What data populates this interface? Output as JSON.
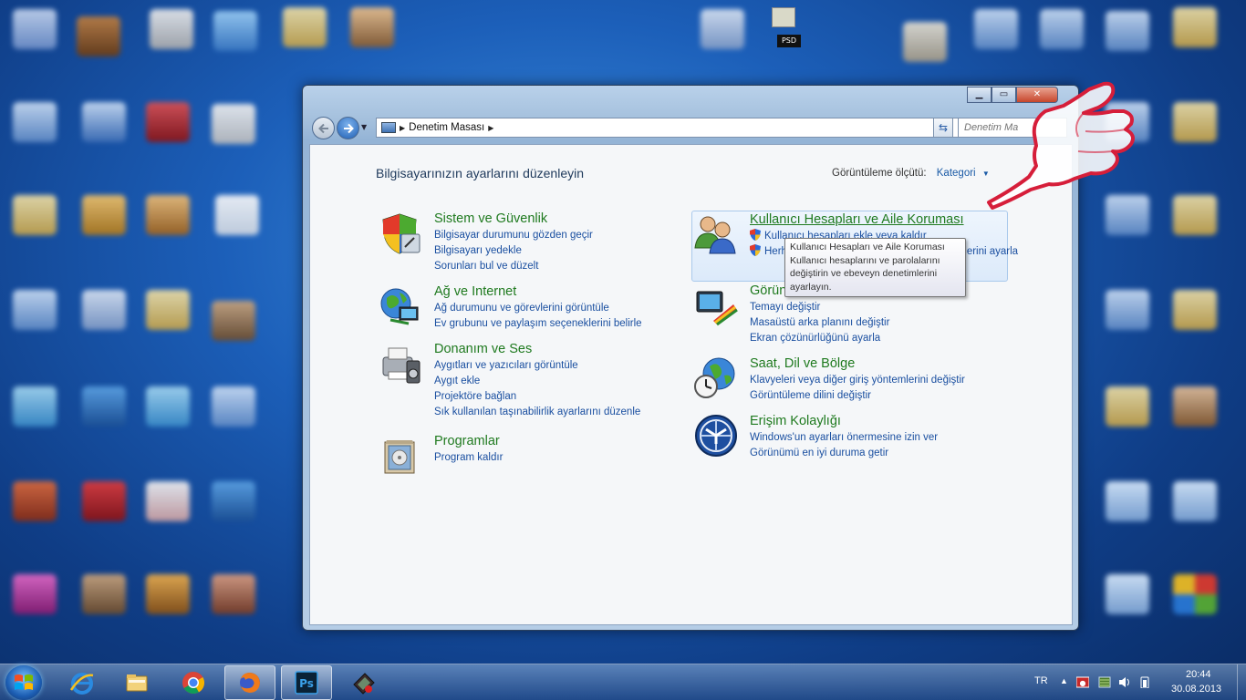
{
  "desktop": {
    "psd_icon_label": "PSD"
  },
  "window": {
    "address": {
      "crumb": "Denetim Masası"
    },
    "search": {
      "placeholder": "Denetim Ma"
    },
    "page_title": "Bilgisayarınızın ayarlarını düzenleyin",
    "view_by": {
      "label": "Görüntüleme ölçütü:",
      "value": "Kategori"
    },
    "left_categories": [
      {
        "title": "Sistem ve Güvenlik",
        "icon": "shield-icon",
        "links": [
          "Bilgisayar durumunu gözden geçir",
          "Bilgisayarı yedekle",
          "Sorunları bul ve düzelt"
        ]
      },
      {
        "title": "Ağ ve Internet",
        "icon": "network-globe-icon",
        "links": [
          "Ağ durumunu ve görevlerini görüntüle",
          "Ev grubunu ve paylaşım seçeneklerini belirle"
        ]
      },
      {
        "title": "Donanım ve Ses",
        "icon": "printer-speaker-icon",
        "links": [
          "Aygıtları ve yazıcıları görüntüle",
          "Aygıt ekle",
          "Projektöre bağlan",
          "Sık kullanılan taşınabilirlik ayarlarını düzenle"
        ]
      },
      {
        "title": "Programlar",
        "icon": "programs-icon",
        "links": [
          "Program kaldır"
        ]
      }
    ],
    "right_categories": [
      {
        "title": "Kullanıcı Hesapları ve Aile Koruması",
        "icon": "users-icon",
        "links": [
          "Kullanıcı hesapları ekle veya kaldır",
          "Herhangi bir kullanıcı için ebeveyn denetimlerini ayarla"
        ]
      },
      {
        "title": "Görünüm ve Kişiselleştirme",
        "icon": "appearance-icon",
        "links": [
          "Temayı değiştir",
          "Masaüstü arka planını değiştir",
          "Ekran çözünürlüğünü ayarla"
        ]
      },
      {
        "title": "Saat, Dil ve Bölge",
        "icon": "clock-globe-icon",
        "links": [
          "Klavyeleri veya diğer giriş yöntemlerini değiştir",
          "Görüntüleme dilini değiştir"
        ]
      },
      {
        "title": "Erişim Kolaylığı",
        "icon": "ease-of-access-icon",
        "links": [
          "Windows'un ayarları önermesine izin ver",
          "Görünümü en iyi duruma getir"
        ]
      }
    ],
    "tooltip": {
      "line1": "Kullanıcı Hesapları ve Aile Koruması",
      "line2": "Kullanıcı hesaplarını ve parolalarını değiştirin ve ebeveyn denetimlerini ayarlayın."
    }
  },
  "taskbar": {
    "apps": [
      "internet-explorer-icon",
      "file-explorer-icon",
      "chrome-icon",
      "firefox-icon",
      "photoshop-icon",
      "app-icon"
    ],
    "ps_label": "Ps",
    "language": "TR",
    "time": "20:44",
    "date": "30.08.2013"
  }
}
